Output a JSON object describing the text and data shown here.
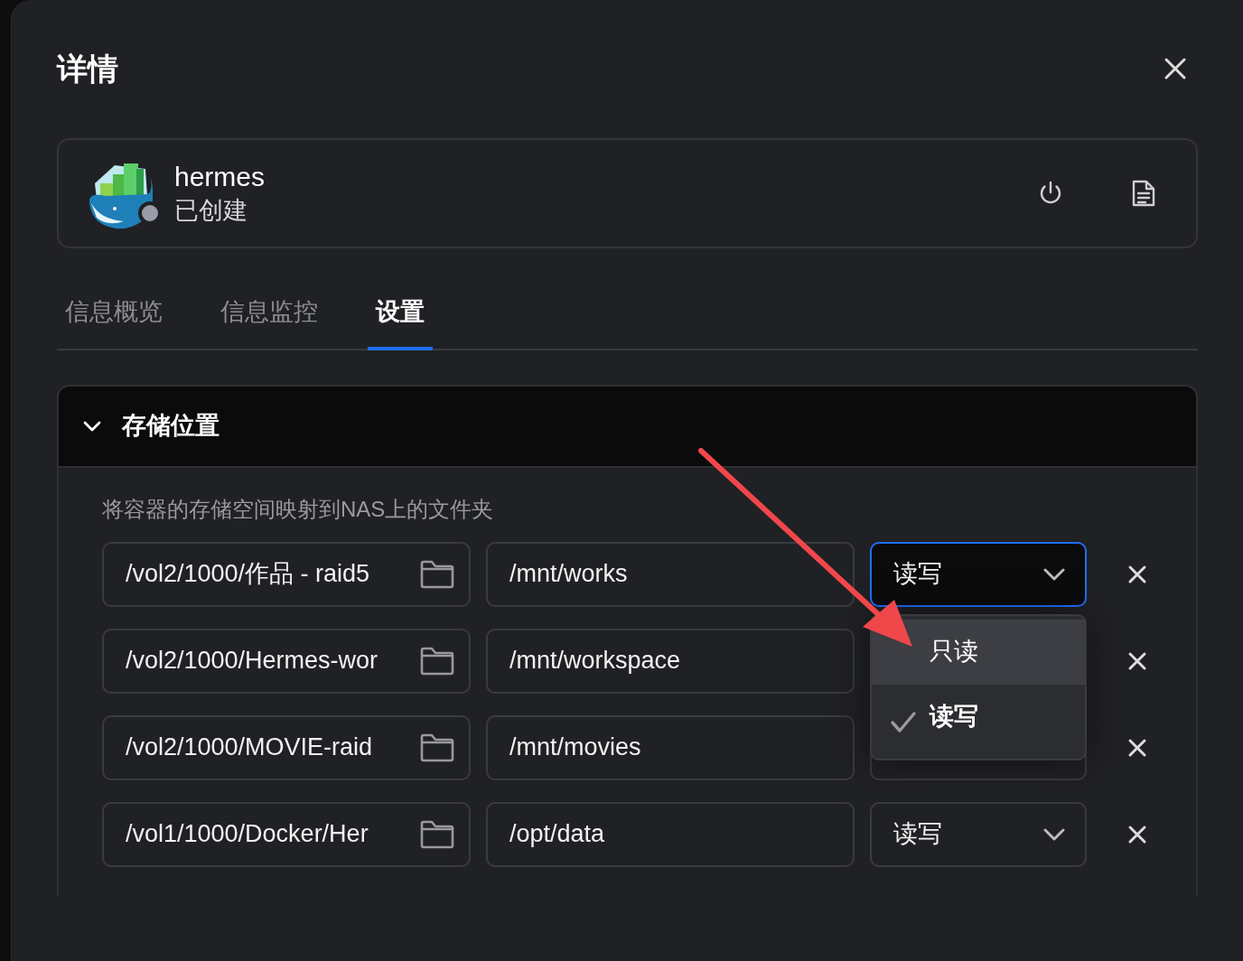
{
  "dialog": {
    "title": "详情"
  },
  "app": {
    "name": "hermes",
    "status": "已创建"
  },
  "tabs": [
    {
      "label": "信息概览",
      "selected": false
    },
    {
      "label": "信息监控",
      "selected": false
    },
    {
      "label": "设置",
      "selected": true
    }
  ],
  "section": {
    "title": "存储位置",
    "expanded": true,
    "description": "将容器的存储空间映射到NAS上的文件夹",
    "mounts": [
      {
        "host_path": "/vol2/1000/作品 - raid5",
        "container_path": "/mnt/works",
        "access": "读写",
        "focused": true
      },
      {
        "host_path": "/vol2/1000/Hermes-wor",
        "container_path": "/mnt/workspace",
        "focused": false
      },
      {
        "host_path": "/vol2/1000/MOVIE-raid",
        "container_path": "/mnt/movies",
        "focused": false
      },
      {
        "host_path": "/vol1/1000/Docker/Her",
        "container_path": "/opt/data",
        "access": "读写",
        "focused": false
      }
    ]
  },
  "dropdown": {
    "options": [
      {
        "label": "只读",
        "selected": false,
        "hovered": true
      },
      {
        "label": "读写",
        "selected": true,
        "hovered": false
      }
    ]
  }
}
